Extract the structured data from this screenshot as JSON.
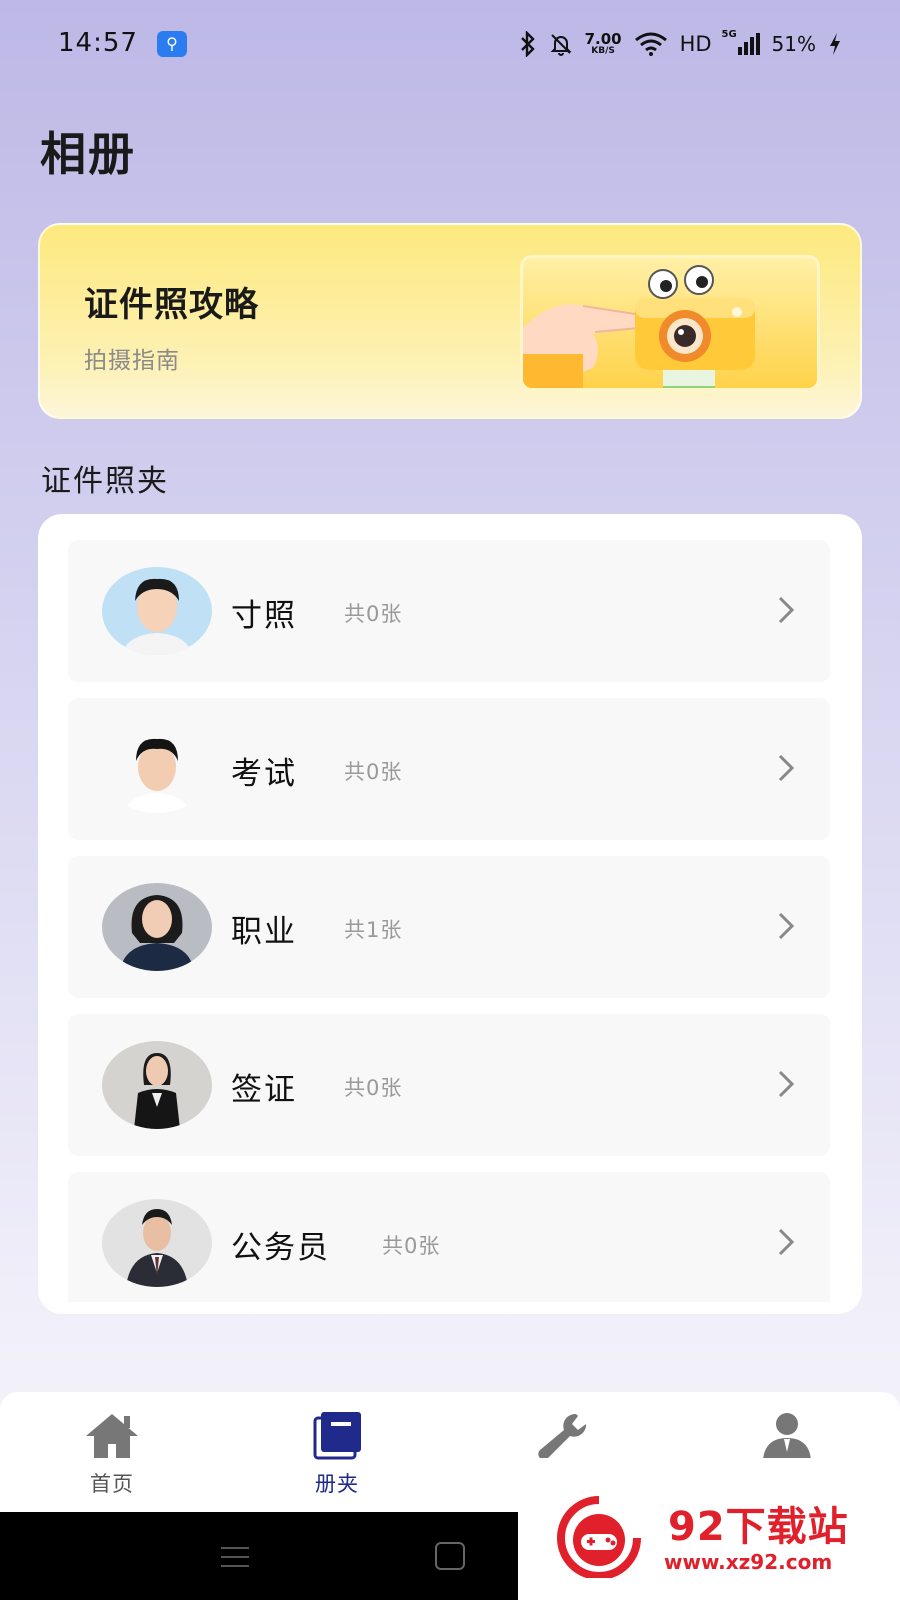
{
  "status_bar": {
    "time": "14:57",
    "usb_icon": "usb-icon",
    "net_speed_value": "7.00",
    "net_speed_unit": "KB/S",
    "network_label": "HD",
    "cell_label": "5G",
    "battery_percent": "51%"
  },
  "page": {
    "title": "相册"
  },
  "guide_banner": {
    "title": "证件照攻略",
    "subtitle": "拍摄指南"
  },
  "section": {
    "title": "证件照夹"
  },
  "folders": [
    {
      "name": "寸照",
      "count": "共0张"
    },
    {
      "name": "考试",
      "count": "共0张"
    },
    {
      "name": "职业",
      "count": "共1张"
    },
    {
      "name": "签证",
      "count": "共0张"
    },
    {
      "name": "公务员",
      "count": "共0张"
    }
  ],
  "bottom_nav": {
    "items": [
      {
        "label": "首页",
        "icon": "home-icon",
        "active": false
      },
      {
        "label": "册夹",
        "icon": "album-icon",
        "active": true
      },
      {
        "label": "",
        "icon": "wrench-icon",
        "active": false
      },
      {
        "label": "",
        "icon": "person-icon",
        "active": false
      }
    ]
  },
  "watermark": {
    "title": "92下载站",
    "url": "www.xz92.com"
  },
  "colors": {
    "active_nav": "#1f2a8a",
    "banner_yellow": "#fde97e",
    "watermark_red": "#e0202a"
  }
}
